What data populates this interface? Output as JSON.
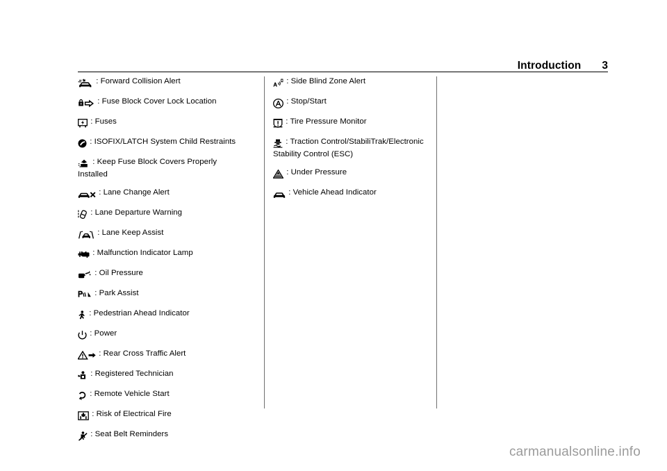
{
  "header": {
    "section_title": "Introduction",
    "page_number": "3"
  },
  "separator": " : ",
  "columns": [
    {
      "id": "column-left",
      "entries": [
        {
          "icon": "forward-collision-alert-icon",
          "label": "Forward Collision Alert"
        },
        {
          "icon": "fuse-block-cover-lock-location-icon",
          "label": "Fuse Block Cover Lock Location"
        },
        {
          "icon": "fuses-icon",
          "label": "Fuses"
        },
        {
          "icon": "isofix-latch-child-restraints-icon",
          "label": "ISOFIX/LATCH System Child Restraints"
        },
        {
          "icon": "keep-fuse-block-covers-installed-icon",
          "label": "Keep Fuse Block Covers Properly Installed"
        },
        {
          "icon": "lane-change-alert-icon",
          "label": "Lane Change Alert"
        },
        {
          "icon": "lane-departure-warning-icon",
          "label": "Lane Departure Warning"
        },
        {
          "icon": "lane-keep-assist-icon",
          "label": "Lane Keep Assist"
        },
        {
          "icon": "malfunction-indicator-lamp-icon",
          "label": "Malfunction Indicator Lamp"
        },
        {
          "icon": "oil-pressure-icon",
          "label": "Oil Pressure"
        },
        {
          "icon": "park-assist-icon",
          "label": "Park Assist"
        },
        {
          "icon": "pedestrian-ahead-indicator-icon",
          "label": "Pedestrian Ahead Indicator"
        },
        {
          "icon": "power-icon",
          "label": "Power"
        },
        {
          "icon": "rear-cross-traffic-alert-icon",
          "label": "Rear Cross Traffic Alert"
        },
        {
          "icon": "registered-technician-icon",
          "label": "Registered Technician"
        },
        {
          "icon": "remote-vehicle-start-icon",
          "label": "Remote Vehicle Start"
        },
        {
          "icon": "risk-of-electrical-fire-icon",
          "label": "Risk of Electrical Fire"
        },
        {
          "icon": "seat-belt-reminders-icon",
          "label": "Seat Belt Reminders"
        }
      ]
    },
    {
      "id": "column-right",
      "entries": [
        {
          "icon": "side-blind-zone-alert-icon",
          "label": "Side Blind Zone Alert"
        },
        {
          "icon": "stop-start-icon",
          "label": "Stop/Start"
        },
        {
          "icon": "tire-pressure-monitor-icon",
          "label": "Tire Pressure Monitor"
        },
        {
          "icon": "traction-control-stabilitrak-icon",
          "label": "Traction Control/StabiliTrak/Electronic Stability Control (ESC)"
        },
        {
          "icon": "under-pressure-icon",
          "label": "Under Pressure"
        },
        {
          "icon": "vehicle-ahead-indicator-icon",
          "label": "Vehicle Ahead Indicator"
        }
      ]
    }
  ],
  "watermark": "carmanualsonline.info",
  "colors": {
    "text": "#000000",
    "rule": "#000000",
    "column_divider": "#6f6f6f",
    "watermark": "#9b9b9b",
    "background": "#ffffff"
  }
}
